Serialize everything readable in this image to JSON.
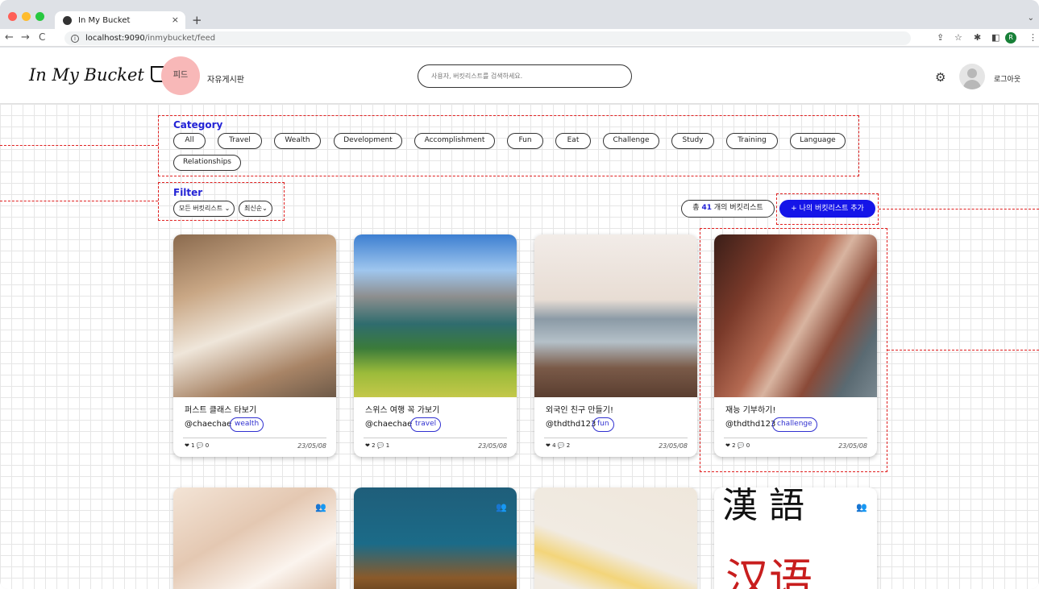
{
  "browser": {
    "tab_title": "In My Bucket",
    "url_host": "localhost:9090",
    "url_path": "/inmybucket/feed",
    "profile_initial": "R"
  },
  "header": {
    "logo": "In My Bucket",
    "nav_feed": "피드",
    "nav_board": "자유게시판",
    "search_placeholder": "사용자, 버킷리스트를 검색하세요.",
    "logout": "로그아웃"
  },
  "category": {
    "title": "Category",
    "items": [
      "All",
      "Travel",
      "Wealth",
      "Development",
      "Accomplishment",
      "Fun",
      "Eat",
      "Challenge",
      "Study",
      "Training",
      "Language",
      "Relationships"
    ]
  },
  "filter": {
    "title": "Filter",
    "scope_selected": "모든 버킷리스트",
    "sort_selected": "최신순"
  },
  "summary": {
    "prefix": "총",
    "count": "41",
    "suffix": "개의 버킷리스트",
    "add_button": "+ 나의 버킷리스트 추가"
  },
  "cards": [
    {
      "title": "퍼스트 클래스 타보기",
      "user": "@chaechae",
      "tag": "wealth",
      "likes": "1",
      "comments": "0",
      "date": "23/05/08"
    },
    {
      "title": "스위스 여행 꼭 가보기",
      "user": "@chaechae",
      "tag": "travel",
      "likes": "2",
      "comments": "1",
      "date": "23/05/08"
    },
    {
      "title": "외국인 친구 만들기!",
      "user": "@thdthd123",
      "tag": "fun",
      "likes": "4",
      "comments": "2",
      "date": "23/05/08"
    },
    {
      "title": "재능 기부하기!",
      "user": "@thdthd123",
      "tag": "challenge",
      "likes": "2",
      "comments": "0",
      "date": "23/05/08"
    }
  ],
  "bottom_cards": {
    "card4_text_top": "漢 語",
    "card4_text_bottom": "汉语"
  },
  "colors": {
    "accent": "#1515e8",
    "feed_bubble": "#f8b8b8",
    "annotation": "#e02020"
  }
}
